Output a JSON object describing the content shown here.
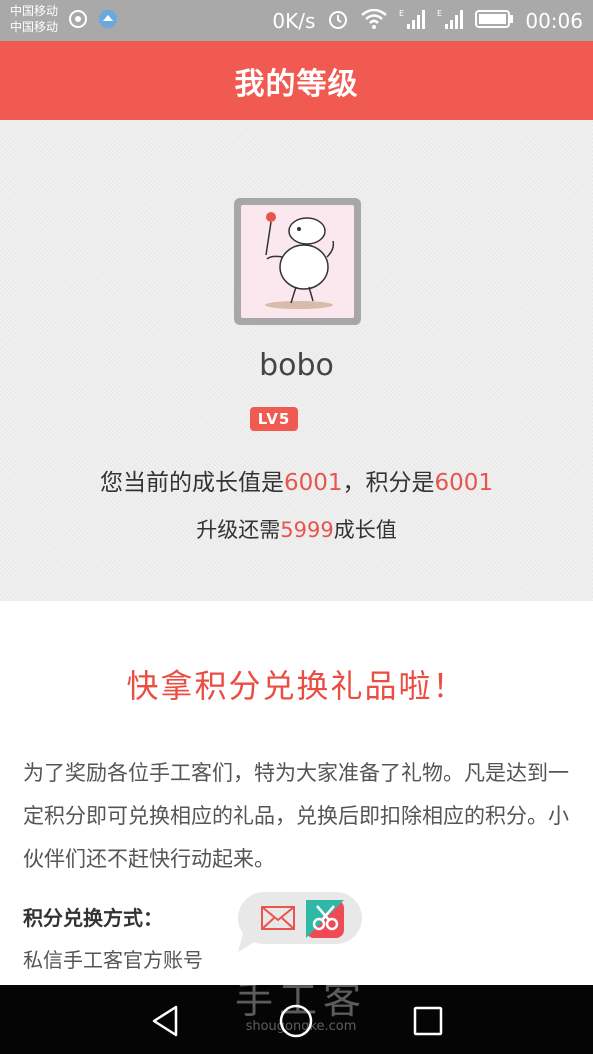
{
  "status_bar": {
    "carrier_1": "中国移动",
    "carrier_2": "中国移动",
    "net_speed": "0K/s",
    "time": "00:06",
    "icons": [
      "hotspot-icon",
      "app-notification-icon",
      "alarm-icon",
      "wifi-icon",
      "signal-icon",
      "signal-icon",
      "battery-icon"
    ]
  },
  "header": {
    "title": "我的等级"
  },
  "profile": {
    "username": "bobo",
    "level_badge": "LV5",
    "growth_prefix": "您当前的成长值是",
    "growth_value": "6001",
    "points_prefix": "，积分是",
    "points_value": "6001",
    "upgrade_prefix": "升级还需",
    "upgrade_value": "5999",
    "upgrade_suffix": "成长值"
  },
  "promo": {
    "title": "快拿积分兑换礼品啦！",
    "body": "为了奖励各位手工客们，特为大家准备了礼物。凡是达到一定积分即可兑换相应的礼品，兑换后即扣除相应的积分。小伙伴们还不赶快行动起来。",
    "redeem_label": "积分兑换方式：",
    "redeem_value": "私信手工客官方账号"
  },
  "watermark": {
    "cn": "手工客",
    "en": "shougongke.com"
  },
  "colors": {
    "accent": "#f05a50",
    "highlight": "#e8554d",
    "status_bar": "#a9a9a9",
    "nav_bar": "#050505"
  }
}
